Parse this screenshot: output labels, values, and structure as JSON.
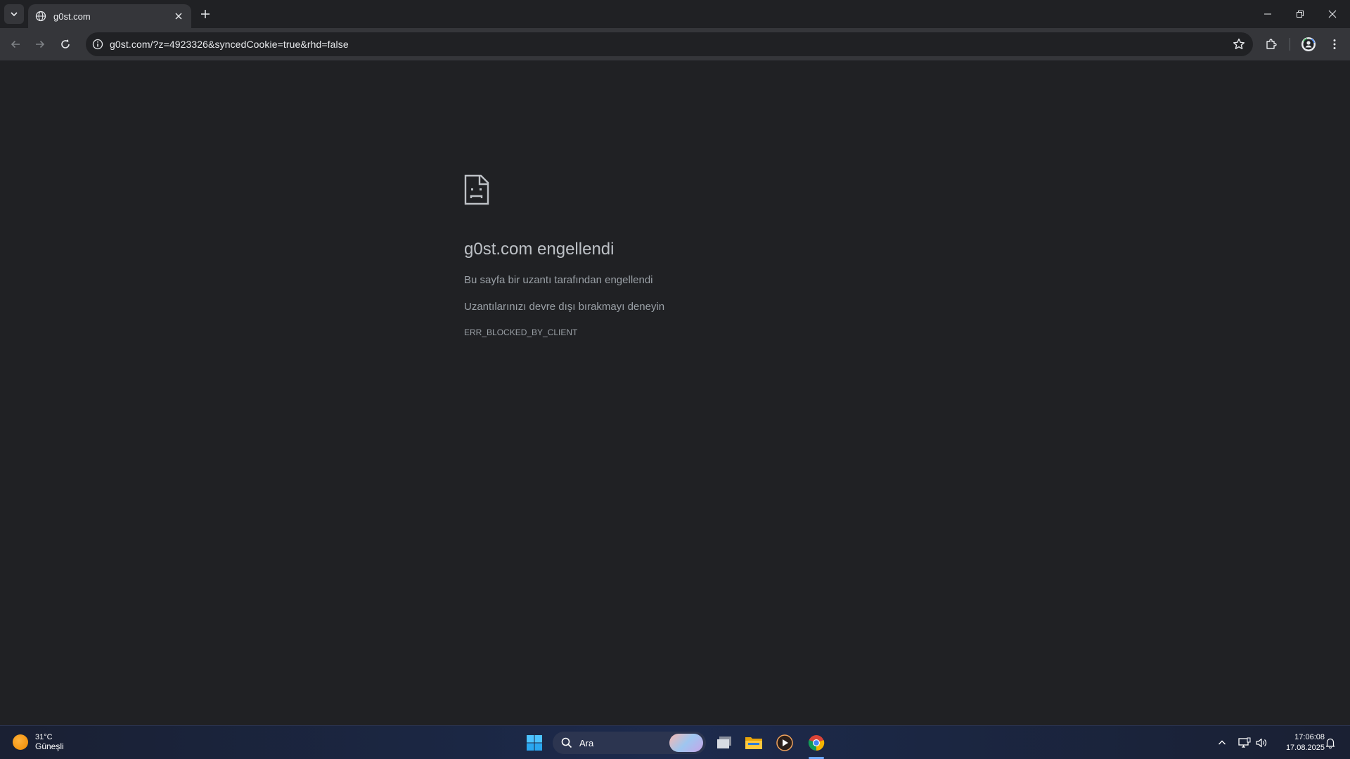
{
  "browser": {
    "tab": {
      "title": "g0st.com"
    },
    "address_bar": {
      "url": "g0st.com/?z=4923326&syncedCookie=true&rhd=false"
    }
  },
  "error_page": {
    "title": "g0st.com engellendi",
    "line1": "Bu sayfa bir uzantı tarafından engellendi",
    "line2": "Uzantılarınızı devre dışı bırakmayı deneyin",
    "code": "ERR_BLOCKED_BY_CLIENT"
  },
  "taskbar": {
    "weather": {
      "temp": "31°C",
      "condition": "Güneşli"
    },
    "search_placeholder": "Ara",
    "clock": {
      "time": "17:06:08",
      "date": "17.08.2025"
    }
  },
  "icons": [
    "tab-search-icon",
    "globe-icon",
    "close-icon",
    "plus-icon",
    "minimize-icon",
    "restore-icon",
    "back-icon",
    "forward-icon",
    "reload-icon",
    "info-icon",
    "star-icon",
    "extensions-icon",
    "profile-icon",
    "kebab-menu-icon",
    "sad-page-icon",
    "sun-icon",
    "windows-start-icon",
    "search-icon",
    "task-view-icon",
    "file-explorer-icon",
    "media-player-icon",
    "chrome-icon",
    "chevron-up-icon",
    "network-icon",
    "volume-icon",
    "bell-icon"
  ],
  "colors": {
    "background": "#202124",
    "toolbar": "#35363a",
    "text_primary": "#bdc1c6",
    "text_secondary": "#9aa0a6"
  }
}
